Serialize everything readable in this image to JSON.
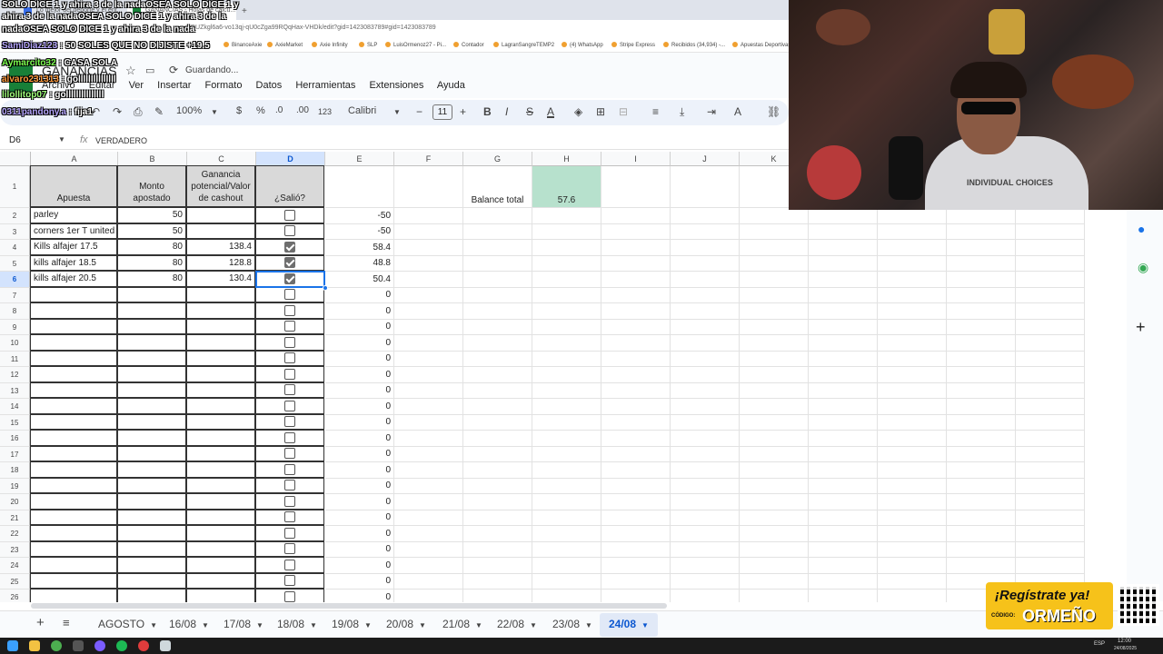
{
  "browser": {
    "tabs": [
      {
        "label": "Lo mejor del deporte y el ent..."
      },
      {
        "label": "GANANCIAS - Hojas de cálcu..."
      }
    ],
    "url": "DUZkgl6a6-vo13qj-qU0cZga99RQqHax-VHDk/edit?gid=1423083789#gid=1423083789",
    "bookmarks": [
      "BinanceAxie",
      "AxieMarket",
      "Axie Infinity",
      "SLP",
      "LuisOrmenoz27 - Pi...",
      "Contador",
      "LagranSangreTEMP2",
      "(4) WhatsApp",
      "Stripe Express",
      "Recibidos (34,934) -...",
      "Apuestas Deportivas"
    ]
  },
  "docs": {
    "title": "GANANCIAS",
    "saving_status": "Guardando...",
    "menu": [
      "Archivo",
      "Editar",
      "Ver",
      "Insertar",
      "Formato",
      "Datos",
      "Herramientas",
      "Extensiones",
      "Ayuda"
    ]
  },
  "toolbar": {
    "zoom": "100%",
    "currency": "$",
    "percent": "%",
    "dec_decrease": ".0",
    "dec_increase": ".00",
    "number_format": "123",
    "font": "Calibri",
    "font_size": "11"
  },
  "formula_bar": {
    "cell_ref": "D6",
    "fx": "fx",
    "formula": "VERDADERO"
  },
  "sheet": {
    "columns": [
      "A",
      "B",
      "C",
      "D",
      "E",
      "F",
      "G",
      "H",
      "I",
      "J",
      "K",
      "",
      "",
      "",
      "",
      ""
    ],
    "selected_column": "D",
    "header_row": {
      "a": "Apuesta",
      "b": "Monto apostado",
      "c": "Ganancia potencial/Valor de cashout",
      "d": "¿Salió?"
    },
    "balance_label": "Balance total",
    "balance_value": "57.6",
    "row_numbers": [
      "1",
      "2",
      "3",
      "4",
      "5",
      "6",
      "7",
      "8",
      "9",
      "10",
      "11",
      "12",
      "13",
      "14",
      "15",
      "16",
      "17",
      "18",
      "19",
      "20",
      "21",
      "22",
      "23",
      "24",
      "25",
      "26"
    ],
    "rows": [
      {
        "a": "parley",
        "b": "50",
        "c": "",
        "checked": false,
        "e": "-50"
      },
      {
        "a": "corners 1er T united",
        "b": "50",
        "c": "",
        "checked": false,
        "e": "-50"
      },
      {
        "a": "Kills alfajer 17.5",
        "b": "80",
        "c": "138.4",
        "checked": true,
        "e": "58.4"
      },
      {
        "a": "kills alfajer 18.5",
        "b": "80",
        "c": "128.8",
        "checked": true,
        "e": "48.8"
      },
      {
        "a": "kills alfajer 20.5",
        "b": "80",
        "c": "130.4",
        "checked": true,
        "e": "50.4"
      }
    ],
    "empty_e_value": "0"
  },
  "sheet_tabs": {
    "tabs": [
      "AGOSTO",
      "16/08",
      "17/08",
      "18/08",
      "19/08",
      "20/08",
      "21/08",
      "22/08",
      "23/08",
      "24/08"
    ],
    "active": "24/08"
  },
  "overlay": {
    "chat": [
      {
        "user": "",
        "text": "SOLO DICE 1 y ahira 3 de la nadaOSEA SOLO DICE 1 y"
      },
      {
        "user": "",
        "text": "ahira 3 de la nadaOSEA SOLO DICE 1 y ahira 3 de la"
      },
      {
        "user": "",
        "text": "nadaOSEA SOLO DICE 1 y ahira 3 de la nada"
      },
      {
        "user": "SamiDiaz123",
        "text": " : 50 SOLES QUE NO DIJISTE +19.5"
      },
      {
        "user": "Aymarcito32",
        "text": " : CASA SOLA"
      },
      {
        "user": "alvaro231313",
        "text": " : golllllllllllllll"
      },
      {
        "user": "lilollitop07",
        "text": " : golllllllllllllll"
      },
      {
        "user": "0311pandony.a",
        "text": " : fija1"
      }
    ],
    "webcam_shirt_text": "INDIVIDUAL CHOICES",
    "promo_title": "¡Regístrate ya!",
    "promo_code_label": "CÓDIGO:",
    "promo_code": "ORMEÑO"
  },
  "taskbar": {
    "language": "ESP",
    "time": "12:00",
    "date": "24/08/2025"
  }
}
